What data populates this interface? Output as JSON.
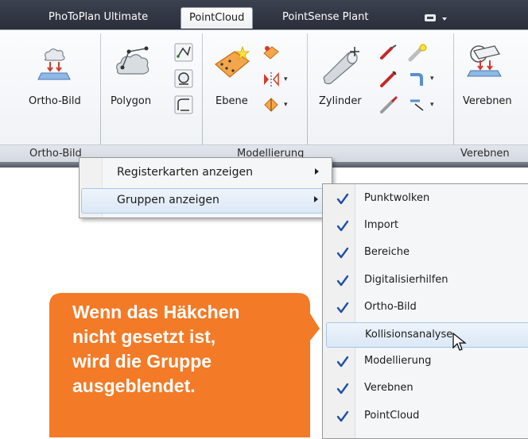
{
  "tabs": [
    {
      "label": "PhoToPlan Ultimate",
      "active": false
    },
    {
      "label": "PointCloud",
      "active": true
    },
    {
      "label": "PointSense Plant",
      "active": false
    }
  ],
  "ribbon": {
    "buttons": {
      "ortho_bild": "Ortho-Bild",
      "polygon": "Polygon",
      "ebene": "Ebene",
      "zylinder": "Zylinder",
      "verebnen": "Verebnen"
    },
    "panels": {
      "ortho_bild": "Ortho-Bild",
      "modellierung": "Modellierung",
      "verebnen": "Verebnen"
    }
  },
  "context_menu": {
    "items": [
      {
        "label": "Registerkarten anzeigen",
        "highlighted": false
      },
      {
        "label": "Gruppen anzeigen",
        "highlighted": true
      }
    ]
  },
  "submenu": {
    "items": [
      {
        "label": "Punktwolken",
        "checked": true
      },
      {
        "label": "Import",
        "checked": true
      },
      {
        "label": "Bereiche",
        "checked": true
      },
      {
        "label": "Digitalisierhilfen",
        "checked": true
      },
      {
        "label": "Ortho-Bild",
        "checked": true
      },
      {
        "label": "Kollisionsanalyse",
        "checked": false,
        "highlighted": true
      },
      {
        "label": "Modellierung",
        "checked": true
      },
      {
        "label": "Verebnen",
        "checked": true
      },
      {
        "label": "PointCloud",
        "checked": true
      }
    ]
  },
  "callout": {
    "text": "Wenn das Häkchen nicht gesetzt ist, wird die Gruppe ausgeblendet."
  },
  "colors": {
    "callout": "#f37a26",
    "check": "#1f4fa8",
    "highlight": "#dbe8f6",
    "tabbar": "#2f333d"
  },
  "icons": {
    "ortho_bild": "ortho-image-icon",
    "polygon": "polygon-cloud-icon",
    "ebene": "plane-icon",
    "zylinder": "cylinder-icon",
    "verebnen": "flatten-icon",
    "cursor": "mouse-pointer-icon"
  }
}
